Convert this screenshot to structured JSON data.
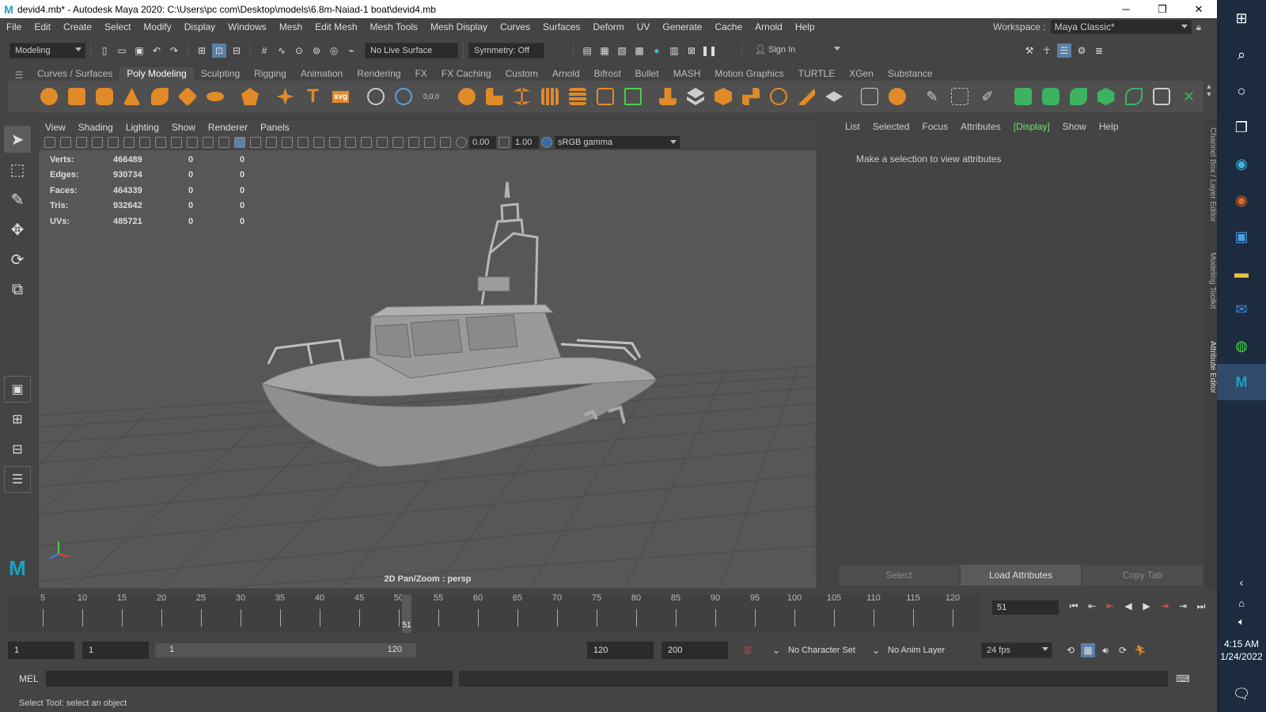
{
  "title_bar": {
    "logo": "M",
    "title": "devid4.mb* - Autodesk Maya 2020: C:\\Users\\pc com\\Desktop\\models\\6.8m-Naiad-1 boat\\devid4.mb",
    "minimize": "─",
    "restore": "❐",
    "close": "✕"
  },
  "menubar": {
    "items": [
      "File",
      "Edit",
      "Create",
      "Select",
      "Modify",
      "Display",
      "Windows",
      "Mesh",
      "Edit Mesh",
      "Mesh Tools",
      "Mesh Display",
      "Curves",
      "Surfaces",
      "Deform",
      "UV",
      "Generate",
      "Cache",
      "Arnold",
      "Help"
    ],
    "workspace_label": "Workspace :",
    "workspace_value": "Maya Classic*"
  },
  "statusline": {
    "mode": "Modeling",
    "live_surface": "No Live Surface",
    "symmetry": "Symmetry: Off",
    "sign_in": "Sign In"
  },
  "shelf": {
    "tabs": [
      "Curves / Surfaces",
      "Poly Modeling",
      "Sculpting",
      "Rigging",
      "Animation",
      "Rendering",
      "FX",
      "FX Caching",
      "Custom",
      "Arnold",
      "Bifrost",
      "Bullet",
      "MASH",
      "Motion Graphics",
      "TURTLE",
      "XGen",
      "Substance"
    ],
    "active_tab": "Poly Modeling",
    "text_tool_glyph": "T",
    "svg_tool_label": "svg",
    "pivot_label": "0,0,0"
  },
  "viewport": {
    "menus": [
      "View",
      "Shading",
      "Lighting",
      "Show",
      "Renderer",
      "Panels"
    ],
    "exposure": "0.00",
    "gamma": "1.00",
    "color_space": "sRGB gamma",
    "hud": [
      {
        "label": "Verts:",
        "value": "466489",
        "a": "0",
        "b": "0"
      },
      {
        "label": "Edges:",
        "value": "930734",
        "a": "0",
        "b": "0"
      },
      {
        "label": "Faces:",
        "value": "464339",
        "a": "0",
        "b": "0"
      },
      {
        "label": "Tris:",
        "value": "932642",
        "a": "0",
        "b": "0"
      },
      {
        "label": "UVs:",
        "value": "485721",
        "a": "0",
        "b": "0"
      }
    ],
    "camera_label": "2D Pan/Zoom : persp"
  },
  "attribute_editor": {
    "tabs": [
      "List",
      "Selected",
      "Focus",
      "Attributes",
      "[Display]",
      "Show",
      "Help"
    ],
    "message": "Make a selection to view attributes",
    "buttons": [
      "Select",
      "Load Attributes",
      "Copy Tab"
    ],
    "side_tabs": [
      "Channel Box / Layer Editor",
      "Modeling Toolkit",
      "Attribute Editor"
    ]
  },
  "time_slider": {
    "labels": [
      "5",
      "10",
      "15",
      "20",
      "25",
      "30",
      "35",
      "40",
      "45",
      "50",
      "55",
      "60",
      "65",
      "70",
      "75",
      "80",
      "85",
      "90",
      "95",
      "100",
      "105",
      "110",
      "115",
      "120"
    ],
    "current_frame": "51"
  },
  "range_slider": {
    "start": "1",
    "playback_start": "1",
    "range_start_label": "1",
    "range_end_label": "120",
    "playback_end": "120",
    "end": "200",
    "character_set": "No Character Set",
    "anim_layer": "No Anim Layer",
    "fps": "24 fps"
  },
  "command_line": {
    "label": "MEL",
    "help": "Select Tool: select an object"
  },
  "taskbar": {
    "time": "4:15 AM",
    "date": "1/24/2022"
  }
}
